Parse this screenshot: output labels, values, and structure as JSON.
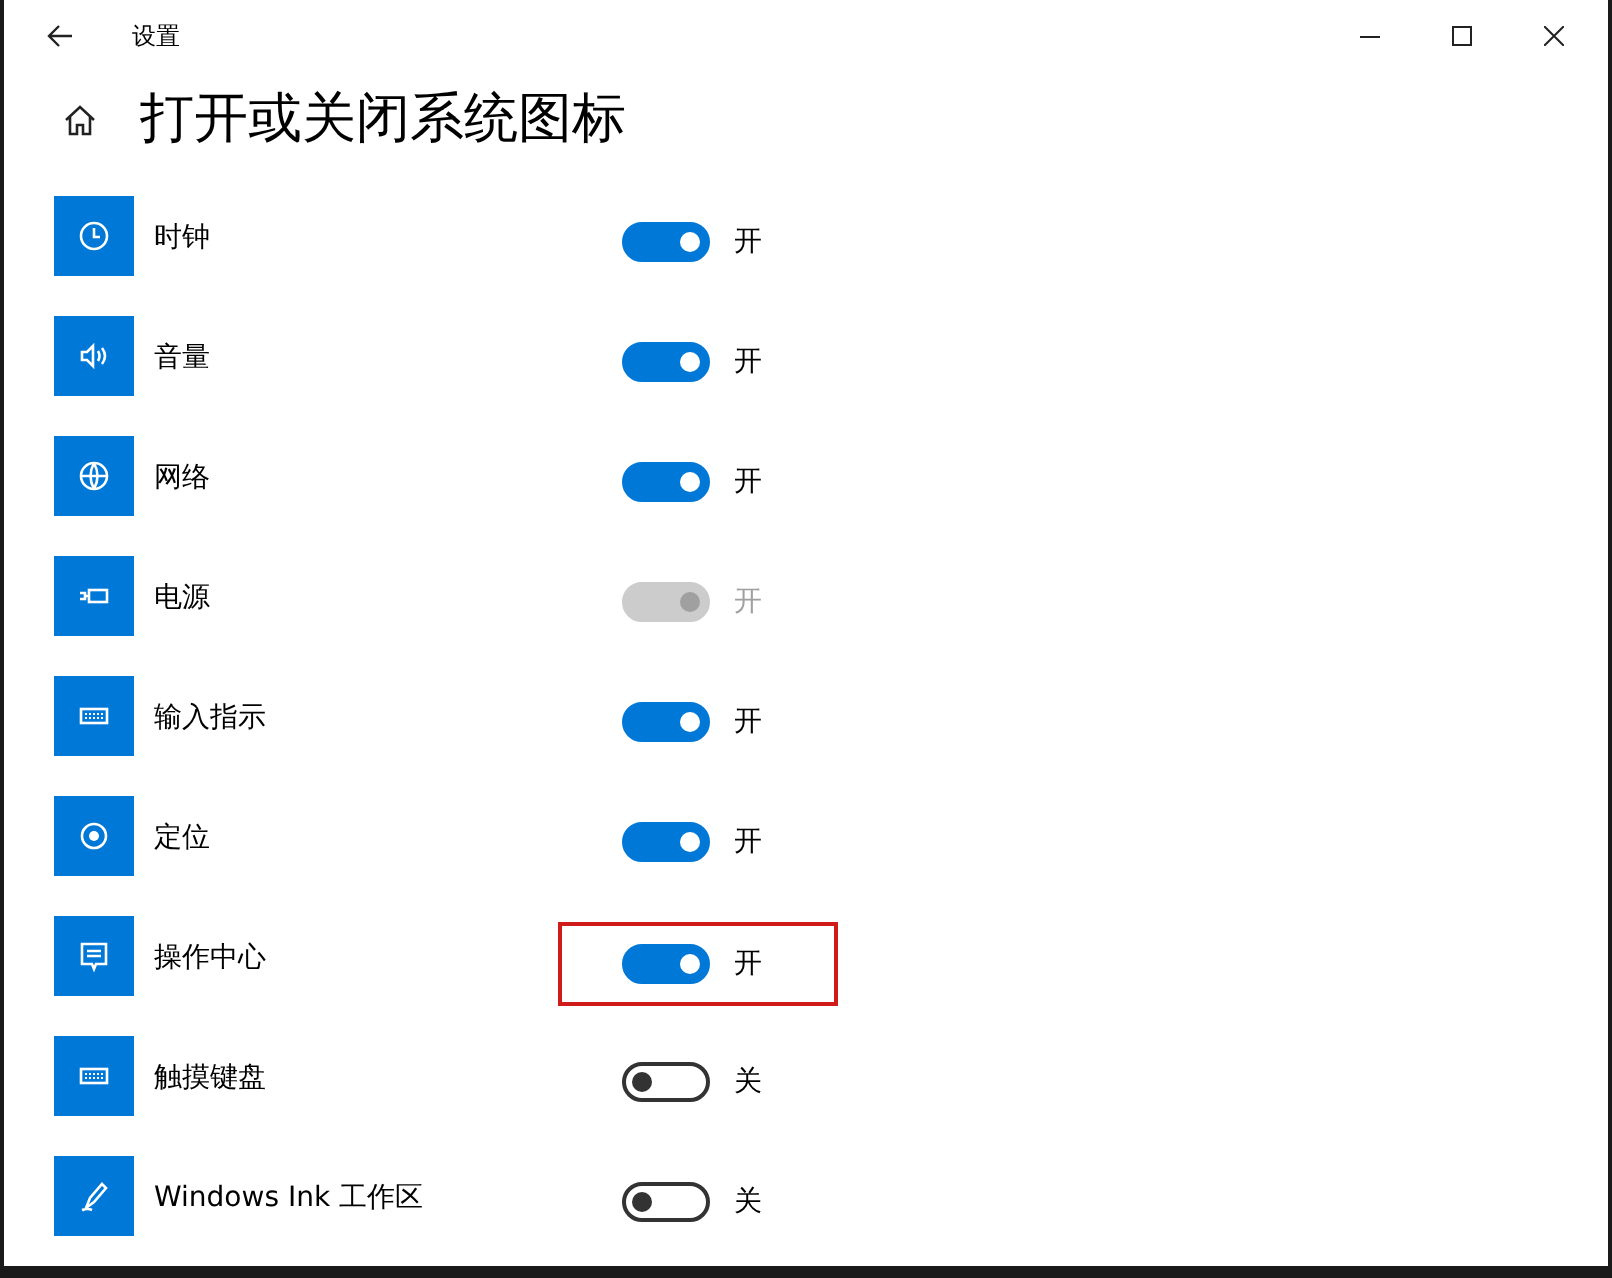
{
  "window": {
    "title": "设置"
  },
  "page": {
    "heading": "打开或关闭系统图标"
  },
  "items": [
    {
      "label": "时钟",
      "on": true,
      "disabled": false,
      "state": "开",
      "highlighted": false
    },
    {
      "label": "音量",
      "on": true,
      "disabled": false,
      "state": "开",
      "highlighted": false
    },
    {
      "label": "网络",
      "on": true,
      "disabled": false,
      "state": "开",
      "highlighted": false
    },
    {
      "label": "电源",
      "on": true,
      "disabled": true,
      "state": "开",
      "highlighted": false
    },
    {
      "label": "输入指示",
      "on": true,
      "disabled": false,
      "state": "开",
      "highlighted": false
    },
    {
      "label": "定位",
      "on": true,
      "disabled": false,
      "state": "开",
      "highlighted": false
    },
    {
      "label": "操作中心",
      "on": true,
      "disabled": false,
      "state": "开",
      "highlighted": true
    },
    {
      "label": "触摸键盘",
      "on": false,
      "disabled": false,
      "state": "关",
      "highlighted": false
    },
    {
      "label": "Windows Ink 工作区",
      "on": false,
      "disabled": false,
      "state": "关",
      "highlighted": false
    }
  ]
}
